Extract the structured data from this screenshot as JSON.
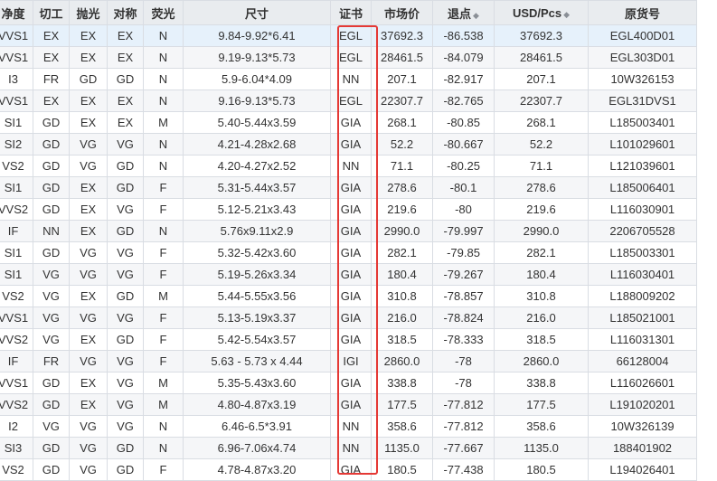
{
  "columns": [
    {
      "key": "clarity",
      "label": "净度",
      "sortable": false
    },
    {
      "key": "cut",
      "label": "切工",
      "sortable": false
    },
    {
      "key": "polish",
      "label": "抛光",
      "sortable": false
    },
    {
      "key": "symmetry",
      "label": "对称",
      "sortable": false
    },
    {
      "key": "fluorescence",
      "label": "荧光",
      "sortable": false
    },
    {
      "key": "size",
      "label": "尺寸",
      "sortable": false
    },
    {
      "key": "cert",
      "label": "证书",
      "sortable": false
    },
    {
      "key": "market_price",
      "label": "市场价",
      "sortable": false
    },
    {
      "key": "discount",
      "label": "退点",
      "sortable": true
    },
    {
      "key": "usd_pcs",
      "label": "USD/Pcs",
      "sortable": true
    },
    {
      "key": "stock_no",
      "label": "原货号",
      "sortable": false
    }
  ],
  "sort_icon": "◆",
  "highlight_color": "#e53935",
  "rows": [
    [
      "VVS1",
      "EX",
      "EX",
      "EX",
      "N",
      "9.84-9.92*6.41",
      "EGL",
      "37692.3",
      "-86.538",
      "37692.3",
      "EGL400D01"
    ],
    [
      "VVS1",
      "EX",
      "EX",
      "EX",
      "N",
      "9.19-9.13*5.73",
      "EGL",
      "28461.5",
      "-84.079",
      "28461.5",
      "EGL303D01"
    ],
    [
      "I3",
      "FR",
      "GD",
      "GD",
      "N",
      "5.9-6.04*4.09",
      "NN",
      "207.1",
      "-82.917",
      "207.1",
      "10W326153"
    ],
    [
      "VVS1",
      "EX",
      "EX",
      "EX",
      "N",
      "9.16-9.13*5.73",
      "EGL",
      "22307.7",
      "-82.765",
      "22307.7",
      "EGL31DVS1"
    ],
    [
      "SI1",
      "GD",
      "EX",
      "EX",
      "M",
      "5.40-5.44x3.59",
      "GIA",
      "268.1",
      "-80.85",
      "268.1",
      "L185003401"
    ],
    [
      "SI2",
      "GD",
      "VG",
      "VG",
      "N",
      "4.21-4.28x2.68",
      "GIA",
      "52.2",
      "-80.667",
      "52.2",
      "L101029601"
    ],
    [
      "VS2",
      "GD",
      "VG",
      "GD",
      "N",
      "4.20-4.27x2.52",
      "NN",
      "71.1",
      "-80.25",
      "71.1",
      "L121039601"
    ],
    [
      "SI1",
      "GD",
      "EX",
      "GD",
      "F",
      "5.31-5.44x3.57",
      "GIA",
      "278.6",
      "-80.1",
      "278.6",
      "L185006401"
    ],
    [
      "VVS2",
      "GD",
      "EX",
      "VG",
      "F",
      "5.12-5.21x3.43",
      "GIA",
      "219.6",
      "-80",
      "219.6",
      "L116030901"
    ],
    [
      "IF",
      "NN",
      "EX",
      "GD",
      "N",
      "5.76x9.11x2.9",
      "GIA",
      "2990.0",
      "-79.997",
      "2990.0",
      "2206705528"
    ],
    [
      "SI1",
      "GD",
      "VG",
      "VG",
      "F",
      "5.32-5.42x3.60",
      "GIA",
      "282.1",
      "-79.85",
      "282.1",
      "L185003301"
    ],
    [
      "SI1",
      "VG",
      "VG",
      "VG",
      "F",
      "5.19-5.26x3.34",
      "GIA",
      "180.4",
      "-79.267",
      "180.4",
      "L116030401"
    ],
    [
      "VS2",
      "VG",
      "EX",
      "GD",
      "M",
      "5.44-5.55x3.56",
      "GIA",
      "310.8",
      "-78.857",
      "310.8",
      "L188009202"
    ],
    [
      "VVS1",
      "VG",
      "VG",
      "VG",
      "F",
      "5.13-5.19x3.37",
      "GIA",
      "216.0",
      "-78.824",
      "216.0",
      "L185021001"
    ],
    [
      "VVS2",
      "VG",
      "EX",
      "GD",
      "F",
      "5.42-5.54x3.57",
      "GIA",
      "318.5",
      "-78.333",
      "318.5",
      "L116031301"
    ],
    [
      "IF",
      "FR",
      "VG",
      "VG",
      "F",
      "5.63 - 5.73 x 4.44",
      "IGI",
      "2860.0",
      "-78",
      "2860.0",
      "66128004"
    ],
    [
      "VVS1",
      "GD",
      "EX",
      "VG",
      "M",
      "5.35-5.43x3.60",
      "GIA",
      "338.8",
      "-78",
      "338.8",
      "L116026601"
    ],
    [
      "VVS2",
      "GD",
      "EX",
      "VG",
      "M",
      "4.80-4.87x3.19",
      "GIA",
      "177.5",
      "-77.812",
      "177.5",
      "L191020201"
    ],
    [
      "I2",
      "VG",
      "VG",
      "VG",
      "N",
      "6.46-6.5*3.91",
      "NN",
      "358.6",
      "-77.812",
      "358.6",
      "10W326139"
    ],
    [
      "SI3",
      "GD",
      "VG",
      "GD",
      "N",
      "6.96-7.06x4.74",
      "NN",
      "1135.0",
      "-77.667",
      "1135.0",
      "188401902"
    ],
    [
      "VS2",
      "GD",
      "VG",
      "GD",
      "F",
      "4.78-4.87x3.20",
      "GIA",
      "180.5",
      "-77.438",
      "180.5",
      "L194026401"
    ]
  ]
}
